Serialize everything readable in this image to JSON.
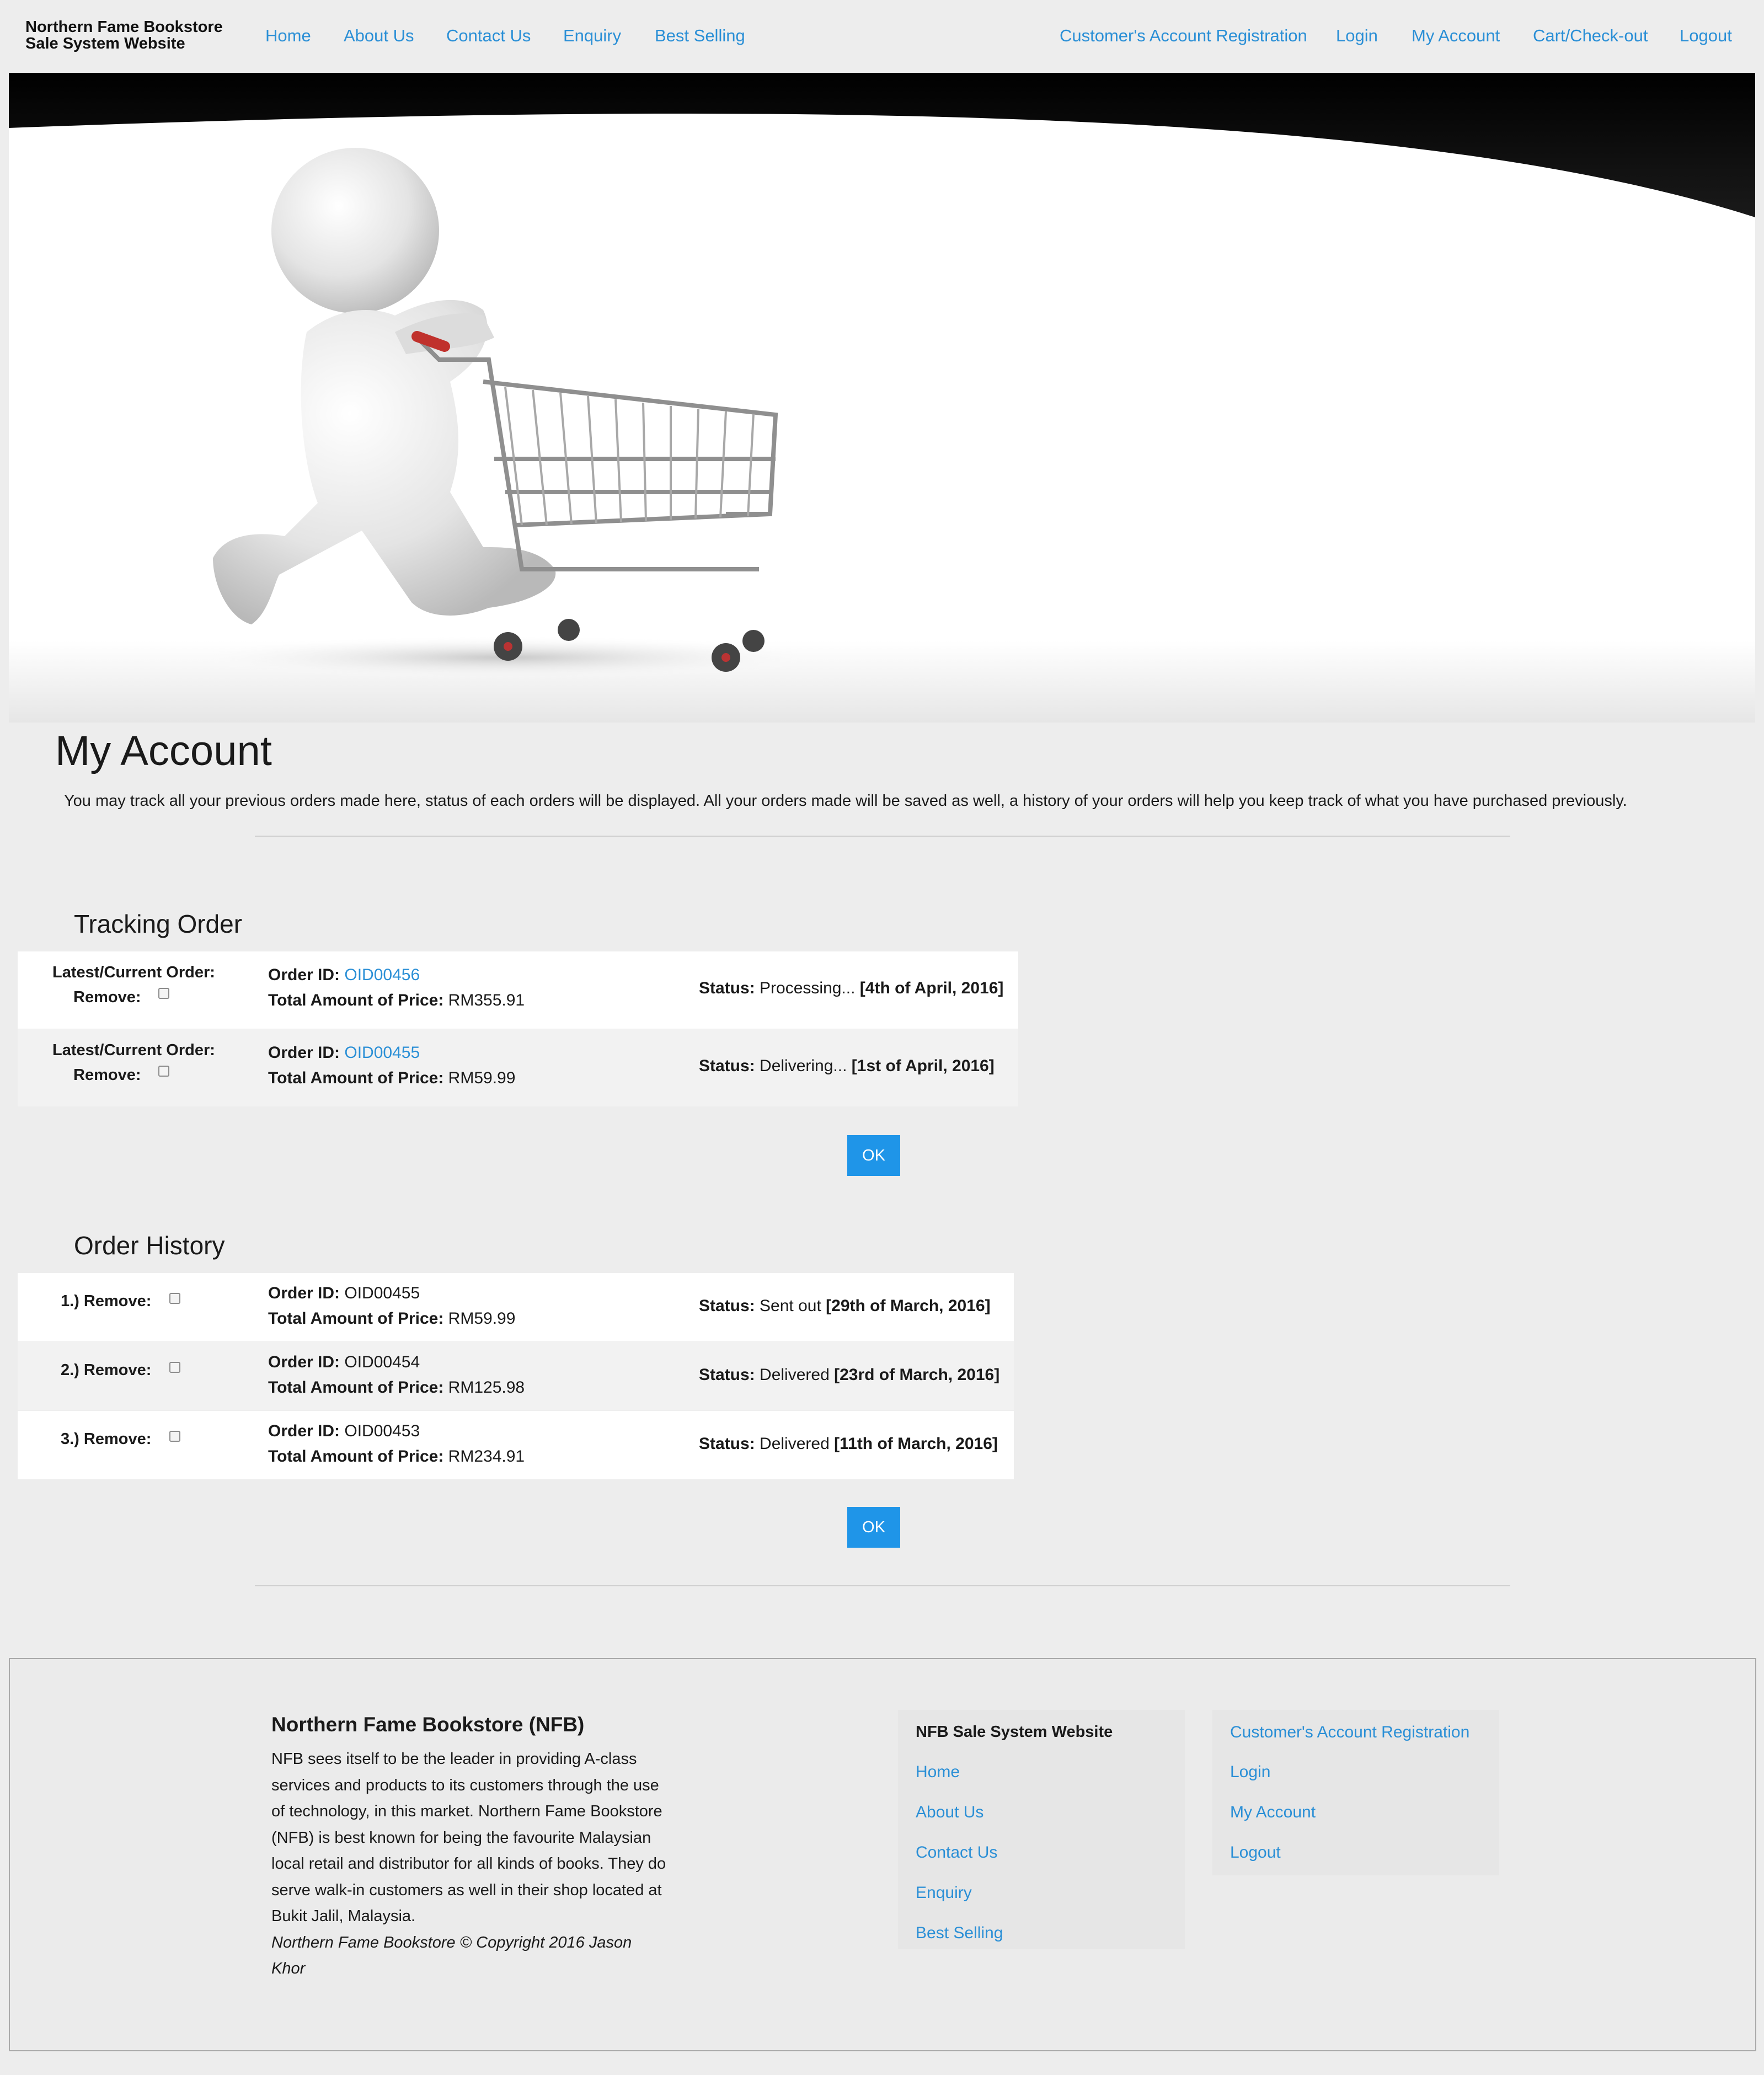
{
  "brand": {
    "line1": "Northern Fame Bookstore",
    "line2": "Sale System Website"
  },
  "nav_left": [
    "Home",
    "About Us",
    "Contact Us",
    "Enquiry",
    "Best Selling"
  ],
  "nav_right": [
    "Customer's Account Registration",
    "Login",
    "My Account",
    "Cart/Check-out",
    "Logout"
  ],
  "page": {
    "title": "My Account",
    "intro": "You may track all your previous orders made here, status of each orders will be displayed. All your orders made will be saved as well, a history of your orders will help you keep track of what you have purchased previously."
  },
  "tracking": {
    "title": "Tracking Order",
    "label_latest": "Latest/Current Order:",
    "label_remove": "Remove:",
    "label_order_id": "Order ID:",
    "label_total": "Total Amount of Price:",
    "label_status": "Status:",
    "rows": [
      {
        "order_id": "OID00456",
        "total": "RM355.91",
        "status": "Processing...",
        "date": "[4th of April, 2016]"
      },
      {
        "order_id": "OID00455",
        "total": "RM59.99",
        "status": "Delivering...",
        "date": "[1st of April, 2016]"
      }
    ],
    "ok_label": "OK"
  },
  "history": {
    "title": "Order History",
    "label_order_id": "Order ID:",
    "label_total": "Total Amount of Price:",
    "label_status": "Status:",
    "rows": [
      {
        "index": "1.) Remove:",
        "order_id": "OID00455",
        "total": "RM59.99",
        "status": "Sent out",
        "date": "[29th of March, 2016]"
      },
      {
        "index": "2.) Remove:",
        "order_id": "OID00454",
        "total": "RM125.98",
        "status": "Delivered",
        "date": "[23rd of March, 2016]"
      },
      {
        "index": "3.) Remove:",
        "order_id": "OID00453",
        "total": "RM234.91",
        "status": "Delivered",
        "date": "[11th of March, 2016]"
      }
    ],
    "ok_label": "OK"
  },
  "footer": {
    "title": "Northern Fame Bookstore (NFB)",
    "body": "NFB sees itself to be the leader in providing A-class services and products to its customers through the use of technology, in this market. Northern Fame Bookstore (NFB) is best known for being the favourite Malaysian local retail and distributor for all kinds of books. They do serve walk-in customers as well in their shop located at Bukit Jalil, Malaysia.",
    "copyright": "Northern Fame Bookstore © Copyright 2016 Jason Khor",
    "links_title": "NFB Sale System Website",
    "links": [
      "Home",
      "About Us",
      "Contact Us",
      "Enquiry",
      "Best Selling"
    ],
    "account_links": [
      "Customer's Account Registration",
      "Login",
      "My Account",
      "Logout"
    ]
  },
  "colors": {
    "link": "#2a8fd6",
    "button": "#1f95e8",
    "background": "#ededed"
  }
}
